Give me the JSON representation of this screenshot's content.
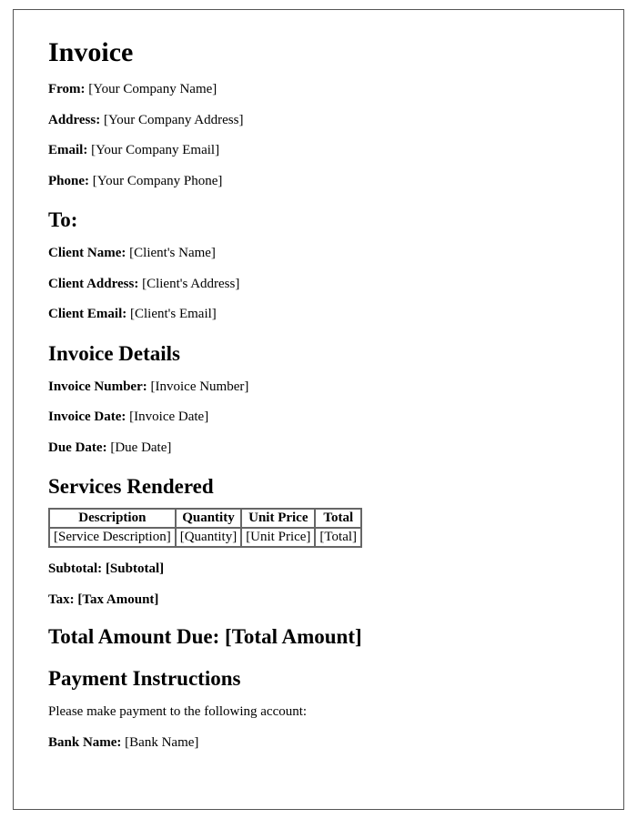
{
  "title": "Invoice",
  "from": {
    "label": "From:",
    "value": "[Your Company Name]",
    "address_label": "Address:",
    "address_value": "[Your Company Address]",
    "email_label": "Email:",
    "email_value": "[Your Company Email]",
    "phone_label": "Phone:",
    "phone_value": "[Your Company Phone]"
  },
  "to": {
    "heading": "To:",
    "name_label": "Client Name:",
    "name_value": "[Client's Name]",
    "address_label": "Client Address:",
    "address_value": "[Client's Address]",
    "email_label": "Client Email:",
    "email_value": "[Client's Email]"
  },
  "details": {
    "heading": "Invoice Details",
    "number_label": "Invoice Number:",
    "number_value": "[Invoice Number]",
    "date_label": "Invoice Date:",
    "date_value": "[Invoice Date]",
    "due_label": "Due Date:",
    "due_value": "[Due Date]"
  },
  "services": {
    "heading": "Services Rendered",
    "columns": [
      "Description",
      "Quantity",
      "Unit Price",
      "Total"
    ],
    "rows": [
      [
        "[Service Description]",
        "[Quantity]",
        "[Unit Price]",
        "[Total]"
      ]
    ]
  },
  "totals": {
    "subtotal_label": "Subtotal:",
    "subtotal_value": "[Subtotal]",
    "tax_label": "Tax:",
    "tax_value": "[Tax Amount]",
    "total_label": "Total Amount Due:",
    "total_value": "[Total Amount]"
  },
  "payment": {
    "heading": "Payment Instructions",
    "intro": "Please make payment to the following account:",
    "bank_label": "Bank Name:",
    "bank_value": "[Bank Name]"
  }
}
